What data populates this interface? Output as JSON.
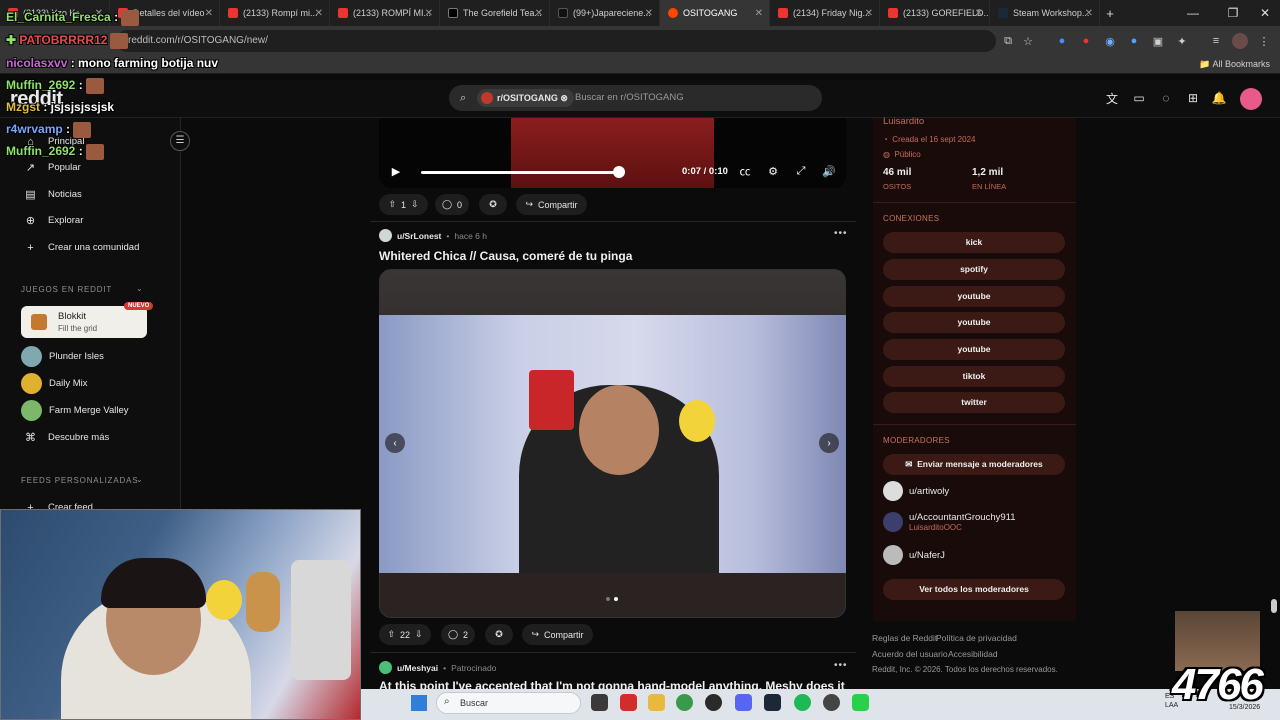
{
  "browser": {
    "tabs": [
      {
        "label": "(2133) Yzo Ke...",
        "active": false
      },
      {
        "label": "Detalles del vídeo",
        "active": false
      },
      {
        "label": "(2133) Rompí mi...",
        "active": false
      },
      {
        "label": "(2133) ROMPÍ MI...",
        "active": false
      },
      {
        "label": "The Gorefield Tea...",
        "active": false
      },
      {
        "label": "(99+)Japareciene...",
        "active": false
      },
      {
        "label": "OSITOGANG",
        "active": true
      },
      {
        "label": "(2134) Friday Nig...",
        "active": false
      },
      {
        "label": "(2133) GOREFIELD...",
        "active": false
      },
      {
        "label": "Steam Workshop...",
        "active": false
      }
    ],
    "url": "reddit.com/r/OSITOGANG/new/",
    "bookmarks_label": "All Bookmarks"
  },
  "chat": [
    {
      "user": "El_Carnita_Fresca",
      "msg": ""
    },
    {
      "user": "PATOBRRRR12",
      "msg": ""
    },
    {
      "user": "nicolasxvv",
      "msg": "mono farming botija nuv"
    },
    {
      "user": "Muffin_2692",
      "msg": ""
    },
    {
      "user": "Mzgst",
      "msg": "jsjsjsjssjsk"
    },
    {
      "user": "r4wrvamp",
      "msg": ""
    },
    {
      "user": "Muffin_2692",
      "msg": ""
    }
  ],
  "reddit": {
    "logo": "reddit",
    "search": {
      "chip": "r/OSITOGANG",
      "placeholder": "Buscar en r/OSITOGANG"
    }
  },
  "sidebar": {
    "items": [
      {
        "label": "Principal",
        "icon": "home-icon"
      },
      {
        "label": "Popular",
        "icon": "popular-icon"
      },
      {
        "label": "Noticias",
        "icon": "news-icon"
      },
      {
        "label": "Explorar",
        "icon": "explore-icon"
      },
      {
        "label": "Crear una comunidad",
        "icon": "plus-icon"
      }
    ],
    "games_header": "JUEGOS EN REDDIT",
    "blokkit": {
      "title": "Blokkit",
      "subtitle": "Fill the grid",
      "badge": "NUEVO"
    },
    "games": [
      {
        "label": "Plunder Isles",
        "color": "#7fa8b0"
      },
      {
        "label": "Daily Mix",
        "color": "#e0b030"
      },
      {
        "label": "Farm Merge Valley",
        "color": "#7bb86a"
      }
    ],
    "discover": "Descubre más",
    "feeds_header": "FEEDS PERSONALIZADAS",
    "create_feed": "Crear feed"
  },
  "post1": {
    "video_time": "0:07 / 0:10",
    "progress": 0.7,
    "votes": "1",
    "comments": "0",
    "share": "Compartir"
  },
  "post2": {
    "user": "u/SrLonest",
    "time": "hace 6 h",
    "title": "Whitered Chica // Causa, comeré de tu pinga",
    "votes": "22",
    "comments": "2",
    "share": "Compartir"
  },
  "post3": {
    "user": "u/Meshyai",
    "tag": "Patrocinado",
    "title": "At this point I've accepted that I'm not gonna hand-model anything. Meshy does it"
  },
  "community": {
    "owner": "Luisardito",
    "created": "Creada el 16 sept 2024",
    "visibility": "Público",
    "members": "46 mil",
    "members_label": "OSITOS",
    "online": "1,2 mil",
    "online_label": "EN LÍNEA",
    "connections_header": "CONEXIONES",
    "connections": [
      "kick",
      "spotify",
      "youtube",
      "youtube",
      "youtube",
      "tiktok",
      "twitter"
    ],
    "moderators_header": "MODERADORES",
    "message_mods": "Enviar mensaje a moderadores",
    "mods": [
      {
        "name": "u/artiwoly",
        "flair": ""
      },
      {
        "name": "u/AccountantGrouchy911",
        "flair": "LuisarditoOOC"
      },
      {
        "name": "u/NaferJ",
        "flair": ""
      }
    ],
    "view_all_mods": "Ver todos los moderadores"
  },
  "footer": {
    "rules": "Reglas de Reddit",
    "privacy": "Política de privacidad",
    "agreement": "Acuerdo del usuario",
    "accessibility": "Accesibilidad",
    "copyright": "Reddit, Inc. © 2026. Todos los derechos reservados."
  },
  "taskbar": {
    "search": "Buscar",
    "lang": "ES",
    "region": "LAA",
    "date": "15/3/2026"
  },
  "overlay_counter": "4766",
  "colors": {
    "accent": "#d9362d",
    "community_bg": "#1a0b0b",
    "pill": "#3b1a15"
  }
}
